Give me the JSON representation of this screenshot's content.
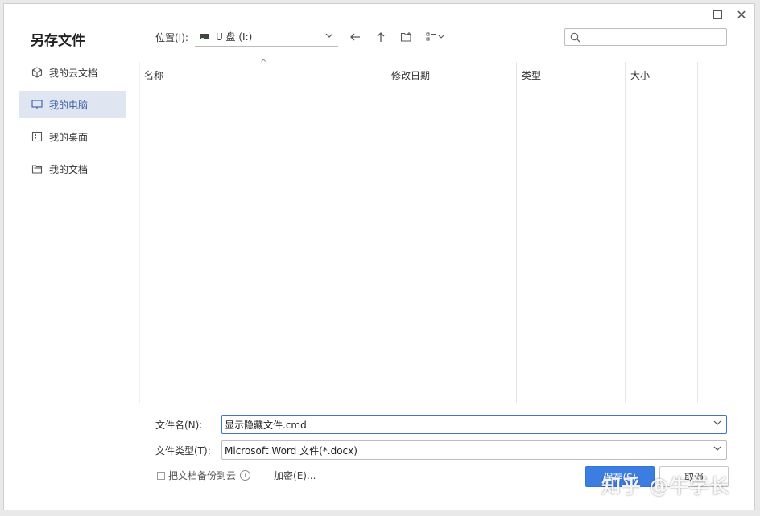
{
  "dialog": {
    "title": "另存文件"
  },
  "sidebar": {
    "items": [
      {
        "label": "我的云文档",
        "icon": "cloud-cube-icon",
        "active": false
      },
      {
        "label": "我的电脑",
        "icon": "monitor-icon",
        "active": true
      },
      {
        "label": "我的桌面",
        "icon": "desktop-icon",
        "active": false
      },
      {
        "label": "我的文档",
        "icon": "folder-icon",
        "active": false
      }
    ]
  },
  "toolbar": {
    "location_label": "位置(I):",
    "location_value": "U 盘 (I:)",
    "search_placeholder": ""
  },
  "filelist": {
    "columns": [
      "名称",
      "修改日期",
      "类型",
      "大小"
    ],
    "rows": []
  },
  "form": {
    "filename_label": "文件名(N):",
    "filename_value": "显示隐藏文件.cmd",
    "filetype_label": "文件类型(T):",
    "filetype_value": "Microsoft Word 文件(*.docx)",
    "backup_label": "把文档备份到云",
    "encrypt_label": "加密(E)...",
    "save_label": "保存(S)",
    "cancel_label": "取消"
  },
  "watermark": "知乎 @牛学长",
  "colors": {
    "accent": "#3b7de0",
    "active_bg": "#dfe6f2",
    "active_text": "#3a5ea8"
  }
}
